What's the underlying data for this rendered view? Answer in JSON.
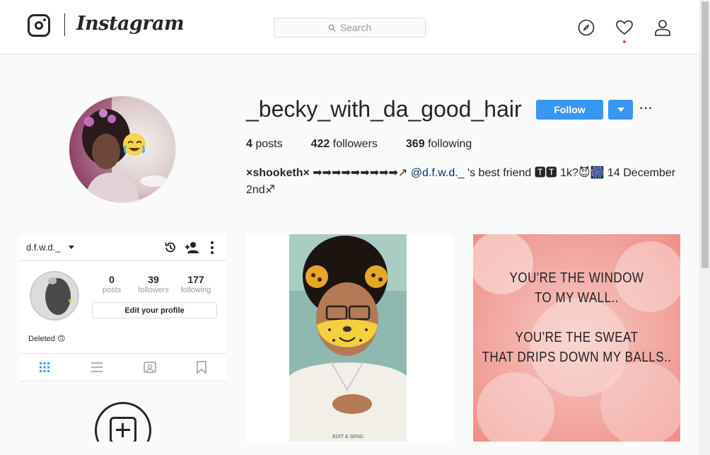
{
  "header": {
    "wordmark": "Instagram",
    "search_placeholder": "Search",
    "icons": [
      "instagram-glyph-icon",
      "explore-compass-icon",
      "activity-heart-icon",
      "profile-person-icon",
      "search-icon"
    ],
    "notification_dot_color": "#ed4956"
  },
  "profile": {
    "username": "_becky_with_da_good_hair",
    "follow_label": "Follow",
    "more_label": "···",
    "accent_color": "#3897f0",
    "stats": {
      "posts_count": "4",
      "posts_label": "posts",
      "followers_count": "422",
      "followers_label": "followers",
      "following_count": "369",
      "following_label": "following"
    },
    "bio": {
      "name": "×shooketh×",
      "arrows": " ➡➡➡➡➡➡➡➡➡↗ ",
      "mention": "@d.f.w.d._",
      "after_mention": " 's best friend 🆃🆃 1k?😈🎆 14 December 2nd♐"
    }
  },
  "posts": [
    {
      "kind": "photo",
      "caption_overlay": "EDIT & SEND"
    },
    {
      "kind": "quote",
      "lines": [
        "YOU'RE THE WINDOW",
        "TO MY WALL..",
        "YOU'RE THE SWEAT",
        "THAT DRIPS DOWN MY BALLS.."
      ]
    },
    {
      "kind": "screenshot",
      "username": "d.f.w.d._",
      "stats": [
        {
          "n": "0",
          "l": "posts"
        },
        {
          "n": "39",
          "l": "followers"
        },
        {
          "n": "177",
          "l": "following"
        }
      ],
      "edit_label": "Edit your profile",
      "bio": "Deleted 🙃"
    }
  ]
}
